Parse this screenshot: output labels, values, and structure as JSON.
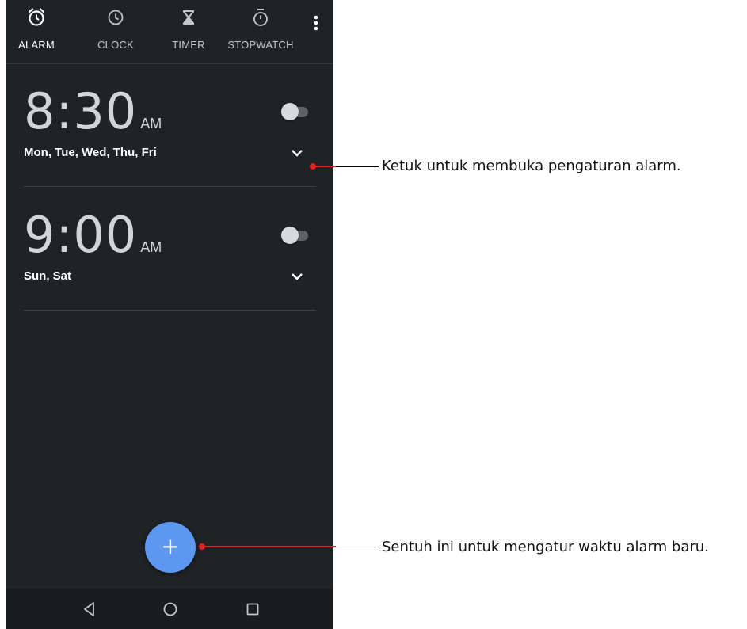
{
  "tabs": [
    {
      "label": "ALARM",
      "icon": "alarm-clock-icon",
      "active": true
    },
    {
      "label": "CLOCK",
      "icon": "clock-icon",
      "active": false
    },
    {
      "label": "TIMER",
      "icon": "hourglass-icon",
      "active": false
    },
    {
      "label": "STOPWATCH",
      "icon": "stopwatch-icon",
      "active": false
    }
  ],
  "menu_icon": "more-vert-icon",
  "alarms": [
    {
      "time": "8:30",
      "ampm": "AM",
      "days": "Mon, Tue, Wed, Thu, Fri",
      "enabled": false
    },
    {
      "time": "9:00",
      "ampm": "AM",
      "days": "Sun, Sat",
      "enabled": false
    }
  ],
  "fab": {
    "label": "+",
    "icon": "plus-icon"
  },
  "navbar": {
    "icons": [
      "back-icon",
      "home-icon",
      "recents-icon"
    ]
  },
  "annotations": [
    {
      "text": "Ketuk untuk membuka pengaturan alarm."
    },
    {
      "text": "Sentuh ini untuk mengatur waktu alarm baru."
    }
  ],
  "colors": {
    "background": "#202326",
    "accent": "#5d97f1",
    "callout_red": "#e0211f",
    "text_primary": "#ffffff",
    "text_secondary": "#c4c6c8"
  }
}
